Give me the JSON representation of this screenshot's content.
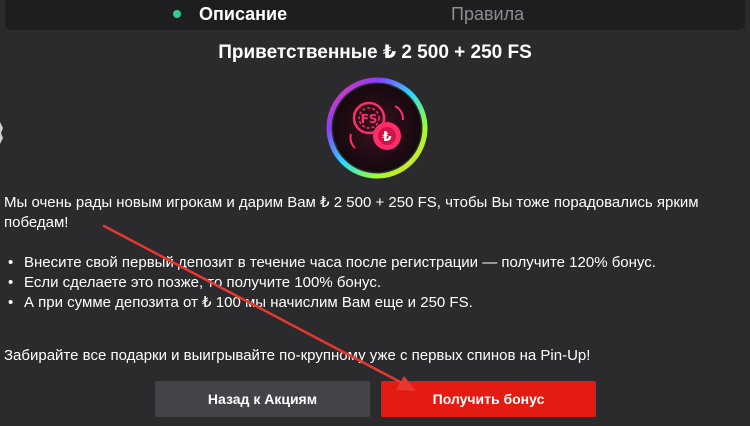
{
  "tabs": {
    "description_label": "Описание",
    "rules_label": "Правила",
    "active_dot_color": "#2fd18a"
  },
  "promo": {
    "title": "Приветственные ₺ 2 500 + 250 FS",
    "icon_text": "FS",
    "icon_currency": "₺",
    "intro_text": "Мы очень рады новым игрокам и дарим Вам ₺ 2 500 + 250 FS, чтобы Вы тоже порадовались ярким победам!",
    "bullets": [
      "Внесите свой первый депозит в течение часа после регистрации — получите 120% бонус.",
      "Если сделаете это позже, то получите 100% бонус.",
      "А при сумме депозита от ₺ 100 мы начислим Вам еще и 250 FS."
    ],
    "closing_text": "Забирайте все подарки и выигрывайте по-крупному уже с первых спинов на Pin-Up!"
  },
  "buttons": {
    "back_label": "Назад к Акциям",
    "get_bonus_label": "Получить бонус",
    "get_bonus_color": "#e31b12"
  },
  "annotation": {
    "arrow_color": "#e8372e"
  }
}
